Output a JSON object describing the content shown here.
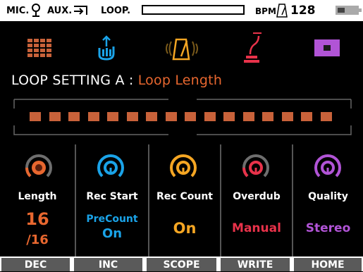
{
  "status": {
    "mic_label": "MIC.",
    "aux_label": "AUX.",
    "loop_label": "LOOP.",
    "bpm_label": "BPM",
    "bpm_value": "128"
  },
  "title": {
    "prefix": "LOOP SETTING A :",
    "parameter": "Loop Length"
  },
  "loop_length": {
    "segments": 16,
    "filled": 16
  },
  "params": [
    {
      "label": "Length",
      "value": "16",
      "value2": "/16",
      "color": "#e8672f"
    },
    {
      "label": "Rec Start",
      "value": "PreCount",
      "value2": "On",
      "color": "#1aa3e8"
    },
    {
      "label": "Rec Count",
      "value": "On",
      "color": "#f5a623"
    },
    {
      "label": "Overdub",
      "value": "Manual",
      "color": "#e8324a"
    },
    {
      "label": "Quality",
      "value": "Stereo",
      "color": "#b154d6"
    }
  ],
  "buttons": {
    "dec": "DEC",
    "inc": "INC",
    "scope": "SCOPE",
    "write": "WRITE",
    "home": "HOME"
  },
  "icons": [
    "mic-icon",
    "aux-icon",
    "metronome-icon",
    "grid-icon",
    "hand-icon",
    "metronome-wave-icon",
    "pedal-icon",
    "stop-icon",
    "battery-icon"
  ]
}
